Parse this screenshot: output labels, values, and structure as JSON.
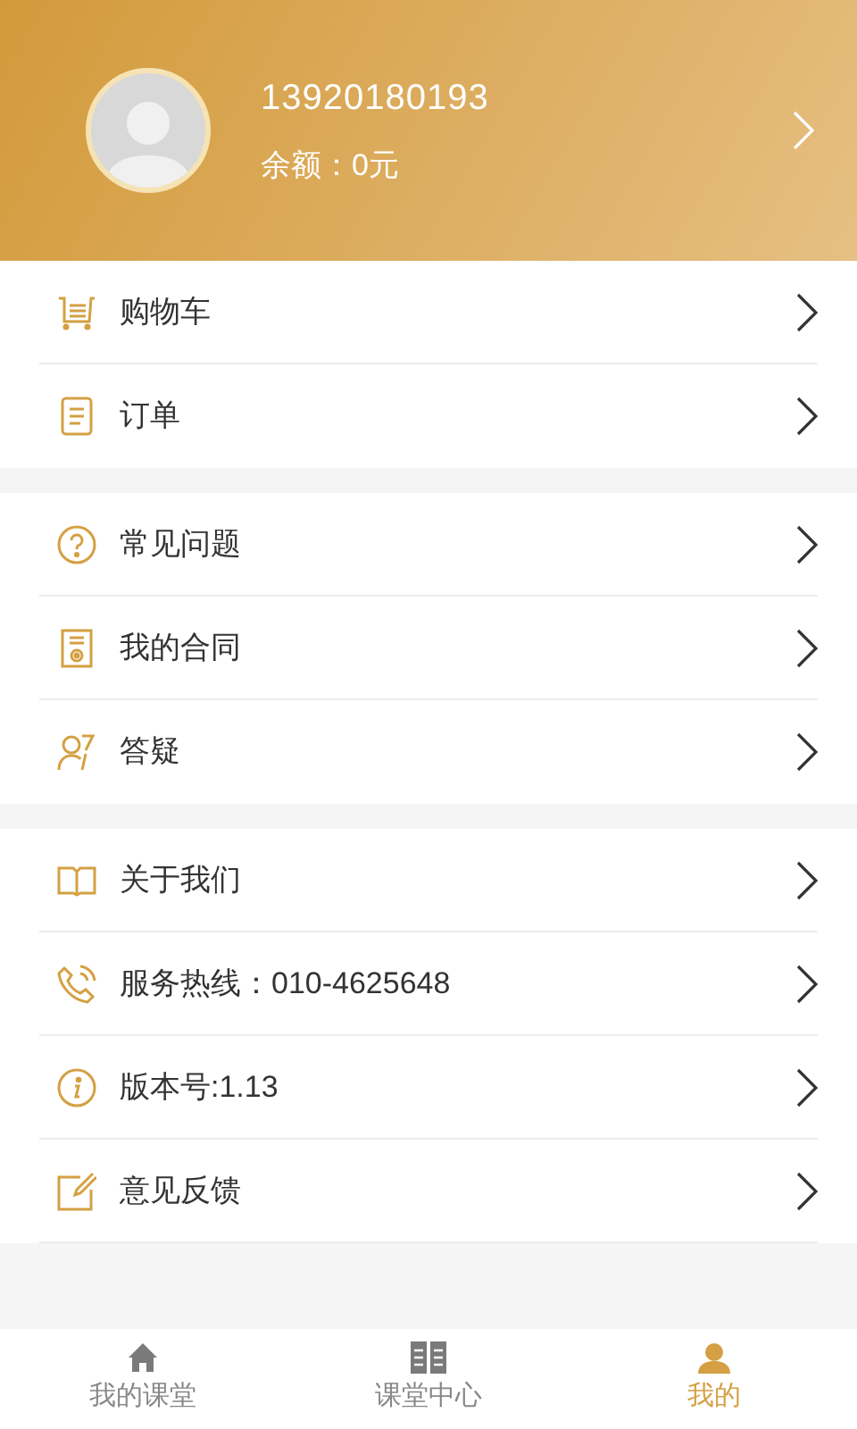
{
  "profile": {
    "phone": "13920180193",
    "balance": "余额：0元"
  },
  "menu_groups": [
    {
      "items": [
        {
          "label": "购物车"
        },
        {
          "label": "订单"
        }
      ]
    },
    {
      "items": [
        {
          "label": "常见问题"
        },
        {
          "label": "我的合同"
        },
        {
          "label": "答疑"
        }
      ]
    },
    {
      "items": [
        {
          "label": "关于我们"
        },
        {
          "label": "服务热线：010-4625648"
        },
        {
          "label": "版本号:1.13"
        },
        {
          "label": "意见反馈"
        }
      ]
    }
  ],
  "tab_bar": [
    {
      "label": "我的课堂",
      "selected": false
    },
    {
      "label": "课堂中心",
      "selected": false
    },
    {
      "label": "我的",
      "selected": true
    }
  ]
}
